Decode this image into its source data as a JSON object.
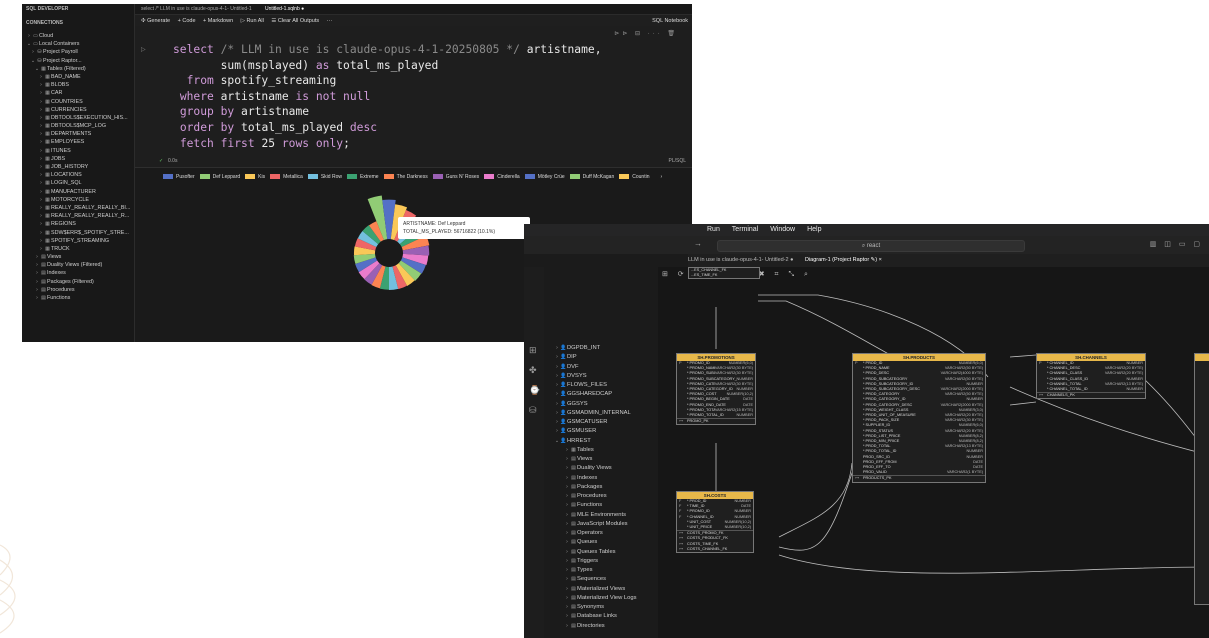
{
  "app": {
    "sidebar_title": "SQL DEVELOPER",
    "connections_label": "CONNECTIONS"
  },
  "sidebar": {
    "items": [
      {
        "label": "Cloud",
        "indent": 1,
        "glyph": "›",
        "icon": "▭"
      },
      {
        "label": "Local Containers",
        "indent": 1,
        "glyph": "⌄",
        "icon": "▭"
      },
      {
        "label": "Project Payroll",
        "indent": 2,
        "glyph": "›",
        "icon": "⛁"
      },
      {
        "label": "Project Raptor...",
        "indent": 2,
        "glyph": "⌄",
        "icon": "⛁"
      },
      {
        "label": "Tables (Filtered)",
        "indent": 3,
        "glyph": "⌄",
        "icon": "▦"
      },
      {
        "label": "BAD_NAME",
        "indent": 4,
        "glyph": "›",
        "icon": "▦"
      },
      {
        "label": "BLOBS",
        "indent": 4,
        "glyph": "›",
        "icon": "▦"
      },
      {
        "label": "CAR",
        "indent": 4,
        "glyph": "›",
        "icon": "▦"
      },
      {
        "label": "COUNTRIES",
        "indent": 4,
        "glyph": "›",
        "icon": "▦"
      },
      {
        "label": "CURRENCIES",
        "indent": 4,
        "glyph": "›",
        "icon": "▦"
      },
      {
        "label": "DBTOOLS$EXECUTION_HIS...",
        "indent": 4,
        "glyph": "›",
        "icon": "▦"
      },
      {
        "label": "DBTOOLS$MCP_LOG",
        "indent": 4,
        "glyph": "›",
        "icon": "▦"
      },
      {
        "label": "DEPARTMENTS",
        "indent": 4,
        "glyph": "›",
        "icon": "▦"
      },
      {
        "label": "EMPLOYEES",
        "indent": 4,
        "glyph": "›",
        "icon": "▦"
      },
      {
        "label": "ITUNES",
        "indent": 4,
        "glyph": "›",
        "icon": "▦"
      },
      {
        "label": "JOBS",
        "indent": 4,
        "glyph": "›",
        "icon": "▦"
      },
      {
        "label": "JOB_HISTORY",
        "indent": 4,
        "glyph": "›",
        "icon": "▦"
      },
      {
        "label": "LOCATIONS",
        "indent": 4,
        "glyph": "›",
        "icon": "▦"
      },
      {
        "label": "LOGIN_SQL",
        "indent": 4,
        "glyph": "›",
        "icon": "▦"
      },
      {
        "label": "MANUFACTURER",
        "indent": 4,
        "glyph": "›",
        "icon": "▦"
      },
      {
        "label": "MOTORCYCLE",
        "indent": 4,
        "glyph": "›",
        "icon": "▦"
      },
      {
        "label": "REALLY_REALLY_REALLY_BI...",
        "indent": 4,
        "glyph": "›",
        "icon": "▦"
      },
      {
        "label": "REALLY_REALLY_REALLY_R...",
        "indent": 4,
        "glyph": "›",
        "icon": "▦"
      },
      {
        "label": "REGIONS",
        "indent": 4,
        "glyph": "›",
        "icon": "▦"
      },
      {
        "label": "SDW$ERR$_SPOTIFY_STRE...",
        "indent": 4,
        "glyph": "›",
        "icon": "▦"
      },
      {
        "label": "SPOTIFY_STREAMING",
        "indent": 4,
        "glyph": "›",
        "icon": "▦"
      },
      {
        "label": "TRUCK",
        "indent": 4,
        "glyph": "›",
        "icon": "▦"
      },
      {
        "label": "Views",
        "indent": 3,
        "glyph": "›",
        "icon": "▤"
      },
      {
        "label": "Duality Views (Filtered)",
        "indent": 3,
        "glyph": "›",
        "icon": "▤"
      },
      {
        "label": "Indexes",
        "indent": 3,
        "glyph": "›",
        "icon": "▤"
      },
      {
        "label": "Packages (Filtered)",
        "indent": 3,
        "glyph": "›",
        "icon": "▤"
      },
      {
        "label": "Procedures",
        "indent": 3,
        "glyph": "›",
        "icon": "▤"
      },
      {
        "label": "Functions",
        "indent": 3,
        "glyph": "›",
        "icon": "▤"
      }
    ]
  },
  "tabs": [
    {
      "label": "select /* LLM in use is claude-opus-4-1- Untitled-1"
    },
    {
      "label": "Untitled-1.sqlnb ●"
    }
  ],
  "toolbar": {
    "generate": "✣ Generate",
    "code": "+ Code",
    "markdown": "+ Markdown",
    "run_all": "▷ Run All",
    "clear_outputs": "☰ Clear All Outputs",
    "more": "···",
    "notebook": "SQL Notebook"
  },
  "editor": {
    "status_time": "0.0s",
    "language": "PL/SQL"
  },
  "chart_data": {
    "type": "pie",
    "variant": "nightingale-rose",
    "series": [
      {
        "categories": [
          "Pusofter",
          "Def Leppard",
          "Kis",
          "Metallica",
          "Skid Row",
          "Extreme",
          "The Darkness",
          "Guns N' Roses",
          "Cinderella",
          "Mötley Crüe",
          "Duff McKagan",
          "Countin"
        ]
      }
    ],
    "legend": [
      "Pusofter",
      "Def Leppard",
      "Kis",
      "Metallica",
      "Skid Row",
      "Extreme",
      "The Darkness",
      "Guns N' Roses",
      "Cinderella",
      "Mötley Crüe",
      "Duff McKagan",
      "Countin"
    ],
    "colors": [
      "#5470c6",
      "#91cc75",
      "#fac858",
      "#ee6666",
      "#73c0de",
      "#3ba272",
      "#fc8452",
      "#9a60b4",
      "#ea7ccc",
      "#5470c6",
      "#91cc75",
      "#fac858"
    ],
    "slices": [
      {
        "value": 10.1,
        "color": "#91cc75"
      },
      {
        "value": 8.5,
        "color": "#5470c6"
      },
      {
        "value": 7.0,
        "color": "#fac858"
      },
      {
        "value": 6.0,
        "color": "#ee6666"
      },
      {
        "value": 5.2,
        "color": "#73c0de"
      },
      {
        "value": 4.6,
        "color": "#3ba272"
      },
      {
        "value": 4.2,
        "color": "#fc8452"
      },
      {
        "value": 3.9,
        "color": "#9a60b4"
      },
      {
        "value": 3.6,
        "color": "#ea7ccc"
      },
      {
        "value": 3.4,
        "color": "#5470c6"
      },
      {
        "value": 3.2,
        "color": "#91cc75"
      },
      {
        "value": 3.0,
        "color": "#fac858"
      },
      {
        "value": 2.9,
        "color": "#ee6666"
      },
      {
        "value": 2.8,
        "color": "#73c0de"
      },
      {
        "value": 2.7,
        "color": "#3ba272"
      },
      {
        "value": 2.6,
        "color": "#fc8452"
      },
      {
        "value": 2.5,
        "color": "#9a60b4"
      },
      {
        "value": 2.4,
        "color": "#ea7ccc"
      },
      {
        "value": 2.3,
        "color": "#5470c6"
      },
      {
        "value": 2.2,
        "color": "#91cc75"
      },
      {
        "value": 2.1,
        "color": "#fac858"
      },
      {
        "value": 2.0,
        "color": "#ee6666"
      },
      {
        "value": 1.9,
        "color": "#73c0de"
      },
      {
        "value": 1.9,
        "color": "#3ba272"
      },
      {
        "value": 1.8,
        "color": "#fc8452"
      }
    ],
    "tooltip": {
      "line1": "ARTISTNAME: Def Leppard",
      "line2": "TOTAL_MS_PLAYED: 56716822 (10.1%)"
    }
  },
  "window2": {
    "menu": [
      "Run",
      "Terminal",
      "Window",
      "Help"
    ],
    "search": "⌕ react",
    "tabs": [
      "LLM in use is claude-opus-4-1- Untitled-2 ●",
      "Diagram-1 (Project Raptor ✎) ×"
    ],
    "tree": [
      {
        "label": "DGPDB_INT",
        "indent": 1,
        "glyph": "›",
        "icon": "👤"
      },
      {
        "label": "DIP",
        "indent": 1,
        "glyph": "›",
        "icon": "👤"
      },
      {
        "label": "DVF",
        "indent": 1,
        "glyph": "›",
        "icon": "👤"
      },
      {
        "label": "DVSYS",
        "indent": 1,
        "glyph": "›",
        "icon": "👤"
      },
      {
        "label": "FLOWS_FILES",
        "indent": 1,
        "glyph": "›",
        "icon": "👤"
      },
      {
        "label": "GGSHAREDCAP",
        "indent": 1,
        "glyph": "›",
        "icon": "👤"
      },
      {
        "label": "GGSYS",
        "indent": 1,
        "glyph": "›",
        "icon": "👤"
      },
      {
        "label": "GSMADMIN_INTERNAL",
        "indent": 1,
        "glyph": "›",
        "icon": "👤"
      },
      {
        "label": "GSMCATUSER",
        "indent": 1,
        "glyph": "›",
        "icon": "👤"
      },
      {
        "label": "GSMUSER",
        "indent": 1,
        "glyph": "›",
        "icon": "👤"
      },
      {
        "label": "HRREST",
        "indent": 1,
        "glyph": "⌄",
        "icon": "👤"
      },
      {
        "label": "Tables",
        "indent": 2,
        "glyph": "›",
        "icon": "▦"
      },
      {
        "label": "Views",
        "indent": 2,
        "glyph": "›",
        "icon": "▤"
      },
      {
        "label": "Duality Views",
        "indent": 2,
        "glyph": "›",
        "icon": "▤"
      },
      {
        "label": "Indexes",
        "indent": 2,
        "glyph": "›",
        "icon": "▤"
      },
      {
        "label": "Packages",
        "indent": 2,
        "glyph": "›",
        "icon": "▤"
      },
      {
        "label": "Procedures",
        "indent": 2,
        "glyph": "›",
        "icon": "▤"
      },
      {
        "label": "Functions",
        "indent": 2,
        "glyph": "›",
        "icon": "▤"
      },
      {
        "label": "MLE Environments",
        "indent": 2,
        "glyph": "›",
        "icon": "▤"
      },
      {
        "label": "JavaScript Modules",
        "indent": 2,
        "glyph": "›",
        "icon": "▤"
      },
      {
        "label": "Operators",
        "indent": 2,
        "glyph": "›",
        "icon": "▤"
      },
      {
        "label": "Queues",
        "indent": 2,
        "glyph": "›",
        "icon": "▤"
      },
      {
        "label": "Queues Tables",
        "indent": 2,
        "glyph": "›",
        "icon": "▤"
      },
      {
        "label": "Triggers",
        "indent": 2,
        "glyph": "›",
        "icon": "▤"
      },
      {
        "label": "Types",
        "indent": 2,
        "glyph": "›",
        "icon": "▤"
      },
      {
        "label": "Sequences",
        "indent": 2,
        "glyph": "›",
        "icon": "▤"
      },
      {
        "label": "Materialized Views",
        "indent": 2,
        "glyph": "›",
        "icon": "▤"
      },
      {
        "label": "Materialized View Logs",
        "indent": 2,
        "glyph": "›",
        "icon": "▤"
      },
      {
        "label": "Synonyms",
        "indent": 2,
        "glyph": "›",
        "icon": "▤"
      },
      {
        "label": "Database Links",
        "indent": 2,
        "glyph": "›",
        "icon": "▤"
      },
      {
        "label": "Directories",
        "indent": 2,
        "glyph": "›",
        "icon": "▤"
      }
    ],
    "tables": [
      {
        "name": "SH.PROMOTIONS",
        "rows": [
          [
            "P",
            "* PROMO_ID",
            "NUMBER(6,0)"
          ],
          [
            "",
            "* PROMO_NAME",
            "VARCHAR2(30 BYTE)"
          ],
          [
            "",
            "* PROMO_SUBCATEGORY",
            "VARCHAR2(30 BYTE)"
          ],
          [
            "",
            "* PROMO_SUBCATEGORY_ID",
            "NUMBER"
          ],
          [
            "",
            "* PROMO_CATEGORY",
            "VARCHAR2(30 BYTE)"
          ],
          [
            "",
            "* PROMO_CATEGORY_ID",
            "NUMBER"
          ],
          [
            "",
            "* PROMO_COST",
            "NUMBER(10,2)"
          ],
          [
            "",
            "* PROMO_BEGIN_DATE",
            "DATE"
          ],
          [
            "",
            "* PROMO_END_DATE",
            "DATE"
          ],
          [
            "",
            "* PROMO_TOTAL",
            "VARCHAR2(15 BYTE)"
          ],
          [
            "",
            "* PROMO_TOTAL_ID",
            "NUMBER"
          ]
        ],
        "keys": [
          "PROMO_PK"
        ]
      },
      {
        "name": "SH.PRODUCTS",
        "rows": [
          [
            "P",
            "* PROD_ID",
            "NUMBER(6,0)"
          ],
          [
            "",
            "* PROD_NAME",
            "VARCHAR2(50 BYTE)"
          ],
          [
            "",
            "* PROD_DESC",
            "VARCHAR2(4000 BYTE)"
          ],
          [
            "",
            "* PROD_SUBCATEGORY",
            "VARCHAR2(50 BYTE)"
          ],
          [
            "",
            "* PROD_SUBCATEGORY_ID",
            "NUMBER"
          ],
          [
            "",
            "* PROD_SUBCATEGORY_DESC",
            "VARCHAR2(2000 BYTE)"
          ],
          [
            "",
            "* PROD_CATEGORY",
            "VARCHAR2(50 BYTE)"
          ],
          [
            "",
            "* PROD_CATEGORY_ID",
            "NUMBER"
          ],
          [
            "",
            "* PROD_CATEGORY_DESC",
            "VARCHAR2(2000 BYTE)"
          ],
          [
            "",
            "* PROD_WEIGHT_CLASS",
            "NUMBER(3,0)"
          ],
          [
            "",
            "* PROD_UNIT_OF_MEASURE",
            "VARCHAR2(20 BYTE)"
          ],
          [
            "",
            "* PROD_PACK_SIZE",
            "VARCHAR2(30 BYTE)"
          ],
          [
            "",
            "* SUPPLIER_ID",
            "NUMBER(6,0)"
          ],
          [
            "",
            "* PROD_STATUS",
            "VARCHAR2(20 BYTE)"
          ],
          [
            "",
            "* PROD_LIST_PRICE",
            "NUMBER(8,2)"
          ],
          [
            "",
            "* PROD_MIN_PRICE",
            "NUMBER(8,2)"
          ],
          [
            "",
            "* PROD_TOTAL",
            "VARCHAR2(13 BYTE)"
          ],
          [
            "",
            "* PROD_TOTAL_ID",
            "NUMBER"
          ],
          [
            "",
            "PROD_SRC_ID",
            "NUMBER"
          ],
          [
            "",
            "PROD_EFF_FROM",
            "DATE"
          ],
          [
            "",
            "PROD_EFF_TO",
            "DATE"
          ],
          [
            "",
            "PROD_VALID",
            "VARCHAR2(1 BYTE)"
          ]
        ],
        "keys": [
          "PRODUCTS_PK"
        ]
      },
      {
        "name": "SH.CHANNELS",
        "rows": [
          [
            "P",
            "* CHANNEL_ID",
            "NUMBER"
          ],
          [
            "",
            "* CHANNEL_DESC",
            "VARCHAR2(20 BYTE)"
          ],
          [
            "",
            "* CHANNEL_CLASS",
            "VARCHAR2(20 BYTE)"
          ],
          [
            "",
            "* CHANNEL_CLASS_ID",
            "NUMBER"
          ],
          [
            "",
            "* CHANNEL_TOTAL",
            "VARCHAR2(13 BYTE)"
          ],
          [
            "",
            "* CHANNEL_TOTAL_ID",
            "NUMBER"
          ]
        ],
        "keys": [
          "CHANNELS_PK"
        ]
      },
      {
        "name": "SH.COSTS",
        "rows": [
          [
            "F",
            "* PROD_ID",
            "NUMBER"
          ],
          [
            "F",
            "* TIME_ID",
            "DATE"
          ],
          [
            "F",
            "* PROMO_ID",
            "NUMBER"
          ],
          [
            "F",
            "* CHANNEL_ID",
            "NUMBER"
          ],
          [
            "",
            "* UNIT_COST",
            "NUMBER(10,2)"
          ],
          [
            "",
            "* UNIT_PRICE",
            "NUMBER(10,2)"
          ]
        ],
        "keys": [
          "COSTS_PROMO_FK",
          "COSTS_PRODUCT_FK",
          "COSTS_TIME_FK",
          "COSTS_CHANNEL_FK"
        ]
      }
    ],
    "partial_rows": [
      "...ES_CHANNEL_FK",
      "...ES_TIME_FK"
    ]
  }
}
